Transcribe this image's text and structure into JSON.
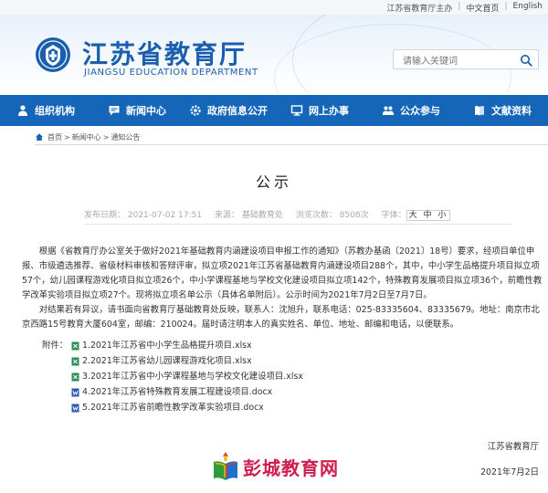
{
  "topbar": {
    "sponsor": "江苏省教育厅主办",
    "chinese_version": "中文首页",
    "english": "English"
  },
  "header": {
    "title": "江苏省教育厅",
    "subtitle": "JIANGSU EDUCATION DEPARTMENT",
    "search_placeholder": "请输入关键词",
    "brand_color": "#1a5fae"
  },
  "nav": {
    "items": [
      {
        "label": "组织机构",
        "icon": "people-icon"
      },
      {
        "label": "新闻中心",
        "icon": "chat-icon"
      },
      {
        "label": "政府信息公开",
        "icon": "gear-icon"
      },
      {
        "label": "网上办事",
        "icon": "monitor-icon"
      },
      {
        "label": "公众参与",
        "icon": "group-icon"
      },
      {
        "label": "文献资料",
        "icon": "book-icon"
      }
    ],
    "bg_color": "#1566b9"
  },
  "breadcrumb": {
    "home": "首页",
    "news": "新闻中心",
    "notice": "通知公告",
    "sep": ">"
  },
  "article": {
    "title": "公示",
    "published": "发布日期：  2021-07-02 17:51",
    "source": "来源：  基础教育处",
    "views": "浏览次数：  8508次",
    "font_label": "字体：",
    "font_sizes": "大 中 小",
    "para1": "根据《省教育厅办公室关于做好2021年基础教育内涵建设项目申报工作的通知》（苏教办基函〔2021〕18号）要求，经项目单位申报、市级遴选推荐、省级材料审核和答辩评审，拟立项2021年江苏省基础教育内涵建设项目288个，其中，中小学生品格提升项目拟立项57个，幼儿园课程游戏化项目拟立项26个，中小学课程基地与学校文化建设项目拟立项142个，特殊教育发展项目拟立项36个，前瞻性教学改革实验项目拟立项27个。现将拟立项名单公示（具体名单附后）。公示时间为2021年7月2日至7月7日。",
    "para2": "对结果若有异议，请书面向省教育厅基础教育处反映，联系人：沈旭升，联系电话：025-83335604、83335679。地址：南京市北京西路15号教育大厦604室，邮编：210024。届时请注明本人的真实姓名、单位、地址、邮编和电话，以便联系。",
    "attachments_label": "附件：",
    "attachments": [
      {
        "name": "1.2021年江苏省中小学生品格提升项目.xlsx",
        "type": "xlsx"
      },
      {
        "name": "2.2021年江苏省幼儿园课程游戏化项目.xlsx",
        "type": "xlsx"
      },
      {
        "name": "3.2021年江苏省中小学课程基地与学校文化建设项目.xlsx",
        "type": "xlsx"
      },
      {
        "name": "4.2021年江苏省特殊教育发展工程建设项目.docx",
        "type": "docx"
      },
      {
        "name": "5.2021年江苏省前瞻性教学改革实验项目.docx",
        "type": "docx"
      }
    ],
    "signature_org": "江苏省教育厅",
    "signature_date": "2021年7月2日"
  },
  "watermark": {
    "text": "彭城教育网"
  }
}
